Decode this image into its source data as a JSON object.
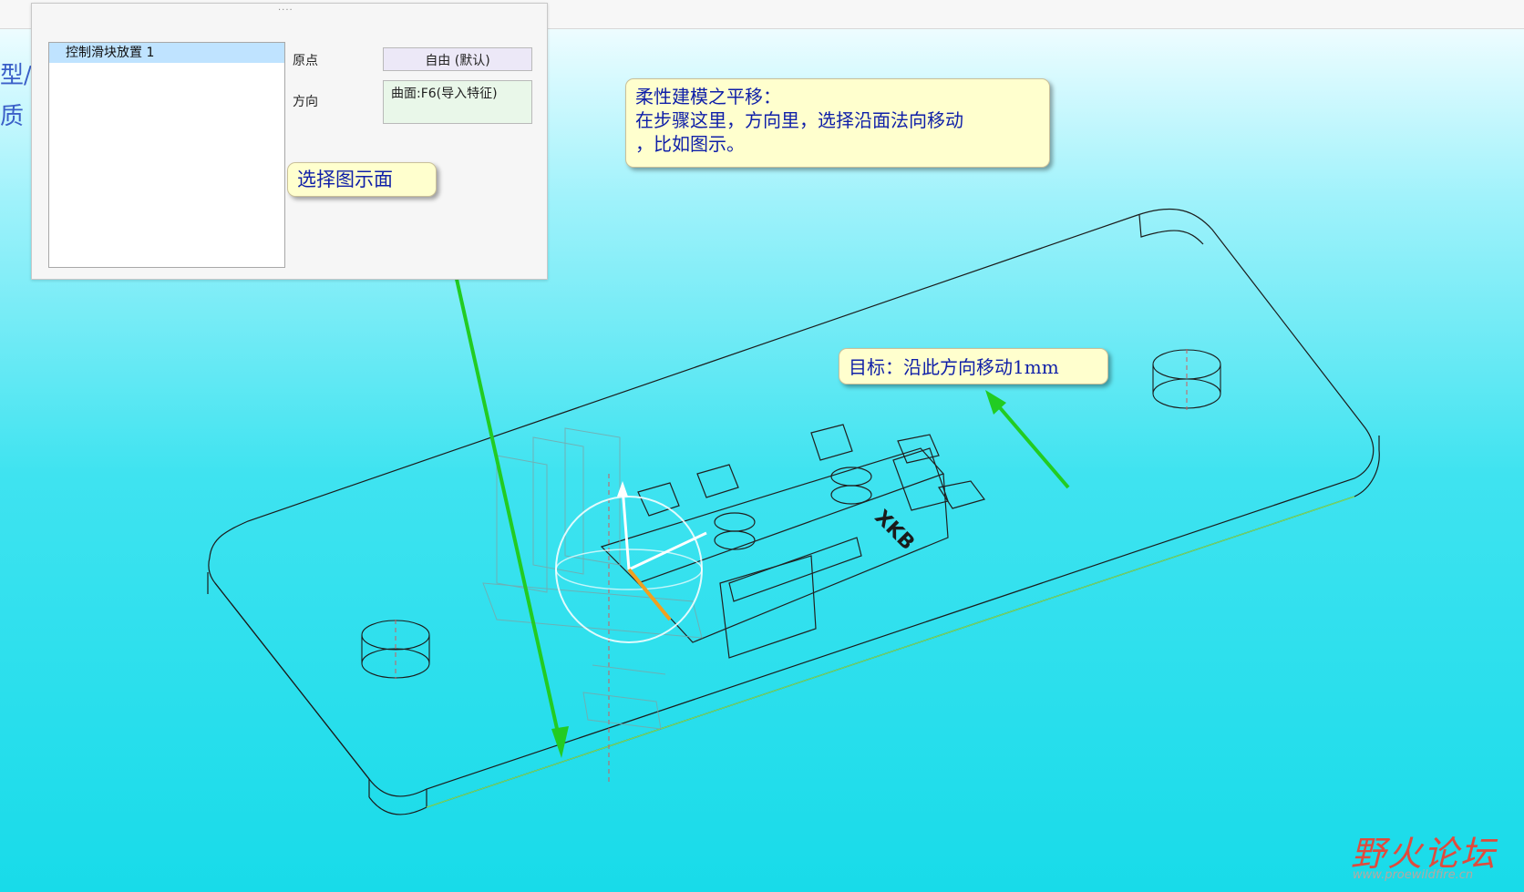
{
  "panel": {
    "list_items": [
      "控制滑块放置 1"
    ],
    "origin_label": "原点",
    "origin_value": "自由 (默认)",
    "direction_label": "方向",
    "direction_value": "曲面:F6(导入特征)"
  },
  "side_text": [
    "型/",
    "质"
  ],
  "callouts": {
    "select_face": "选择图示面",
    "title": "柔性建模之平移：",
    "body_line1": "在步骤这里，方向里，选择沿面法向移动",
    "body_line2": "，比如图示。",
    "target": "目标：沿此方向移动1mm"
  },
  "model": {
    "part_marking": "XKB"
  },
  "watermark": {
    "logo": "野火论坛",
    "url": "www.proewildfire.cn"
  },
  "colors": {
    "arrow": "#22cc22",
    "callout_bg": "#ffffce",
    "callout_text": "#0f1fa8"
  }
}
